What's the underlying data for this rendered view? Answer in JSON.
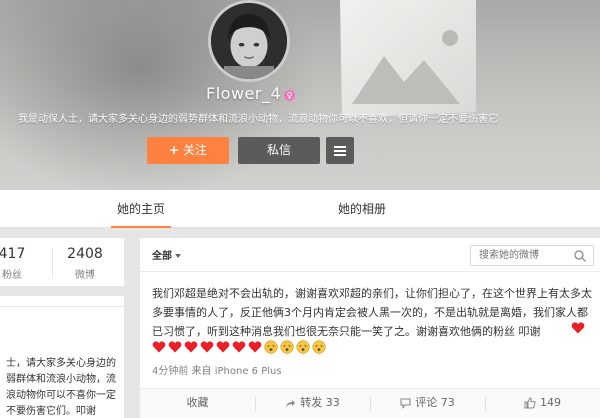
{
  "profile": {
    "username": "Flower_4",
    "bio": "我是动保人士，请大家多关心身边的弱势群体和流浪小动物，流浪动物你可以不喜欢，但请你一定不要伤害它",
    "follow_label": "关注",
    "follow_plus": "+",
    "message_label": "私信"
  },
  "tabs": {
    "home": "她的主页",
    "album": "她的相册"
  },
  "stats": {
    "fans_count": "417",
    "fans_label": "粉丝",
    "weibo_count": "2408",
    "weibo_label": "微博"
  },
  "left_intro": {
    "text": "士，请大家多关心身边的弱群体和流浪小动物，流浪动物你可以不喜你一定不要伤害它们。叩谢"
  },
  "feed": {
    "filter_label": "全部",
    "search_placeholder": "搜索她的微博",
    "post_text": "我们邓超是绝对不会出轨的，谢谢喜欢邓超的亲们，让你们担心了，在这个世界上有太多太多要事情的人了，反正他俩3个月内肯定会被人黑一次的，不是出轨就是离婚，我们家人都已习惯了，听到这种消息我们也很无奈只能一笑了之。谢谢喜欢他俩的粉丝 叩谢",
    "emojis": [
      "heart",
      "heart",
      "heart",
      "heart",
      "heart",
      "heart",
      "heart",
      "sleepy-face",
      "sleepy-face",
      "sleepy-face",
      "sleepy-face"
    ],
    "post_meta": "4分钟前 来自 iPhone 6 Plus",
    "actions": {
      "favorite": "收藏",
      "forward": "转发 33",
      "comment": "评论 73",
      "like": "149"
    }
  },
  "colors": {
    "accent": "#ff8140",
    "dark_button": "#5b5b5b",
    "heart": "#e8202a",
    "emoji_face": "#f6c744"
  }
}
